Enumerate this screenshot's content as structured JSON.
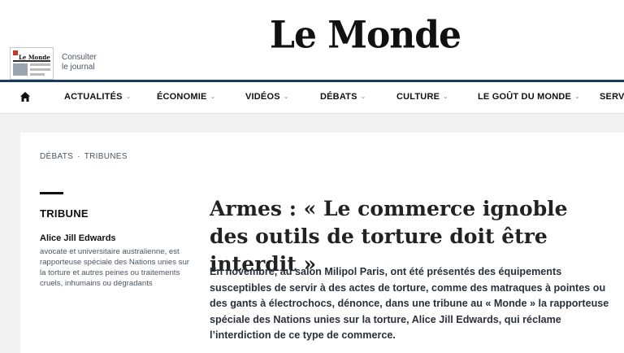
{
  "header": {
    "logo": "Le Monde",
    "journal_masthead": "Le Monde",
    "consult_line1": "Consulter",
    "consult_line2": "le journal"
  },
  "nav": {
    "items": [
      {
        "label": "ACTUALITÉS",
        "has_dropdown": true
      },
      {
        "label": "ÉCONOMIE",
        "has_dropdown": true
      },
      {
        "label": "VIDÉOS",
        "has_dropdown": true
      },
      {
        "label": "DÉBATS",
        "has_dropdown": true
      },
      {
        "label": "CULTURE",
        "has_dropdown": true
      },
      {
        "label": "LE GOÛT DU MONDE",
        "has_dropdown": true
      },
      {
        "label": "SERVIC",
        "has_dropdown": false
      }
    ]
  },
  "breadcrumb": {
    "items": [
      "DÉBATS",
      "TRIBUNES"
    ],
    "separator": "·"
  },
  "article": {
    "kicker": "TRIBUNE",
    "author_name": "Alice Jill Edwards",
    "author_desc": "avocate et universitaire australienne, est rapporteuse spéciale des Nations unies sur la torture et autres peines ou traitements cruels, inhumains ou dégradants",
    "headline": "Armes : « Le commerce ignoble des outils de torture doit être interdit »",
    "lead": "En novembre, au salon Milipol Paris, ont été présentés des équipements susceptibles de servir à des actes de torture, comme des matraques à pointes ou des gants à électrochocs, dénonce, dans une tribune au « Monde » la rapporteuse spéciale des Nations unies sur la torture, Alice Jill Edwards, qui réclame l’interdiction de ce type de commerce."
  },
  "colors": {
    "nav_line": "#1a3a5c",
    "text": "#2a303b",
    "background": "#f2f2f2"
  }
}
